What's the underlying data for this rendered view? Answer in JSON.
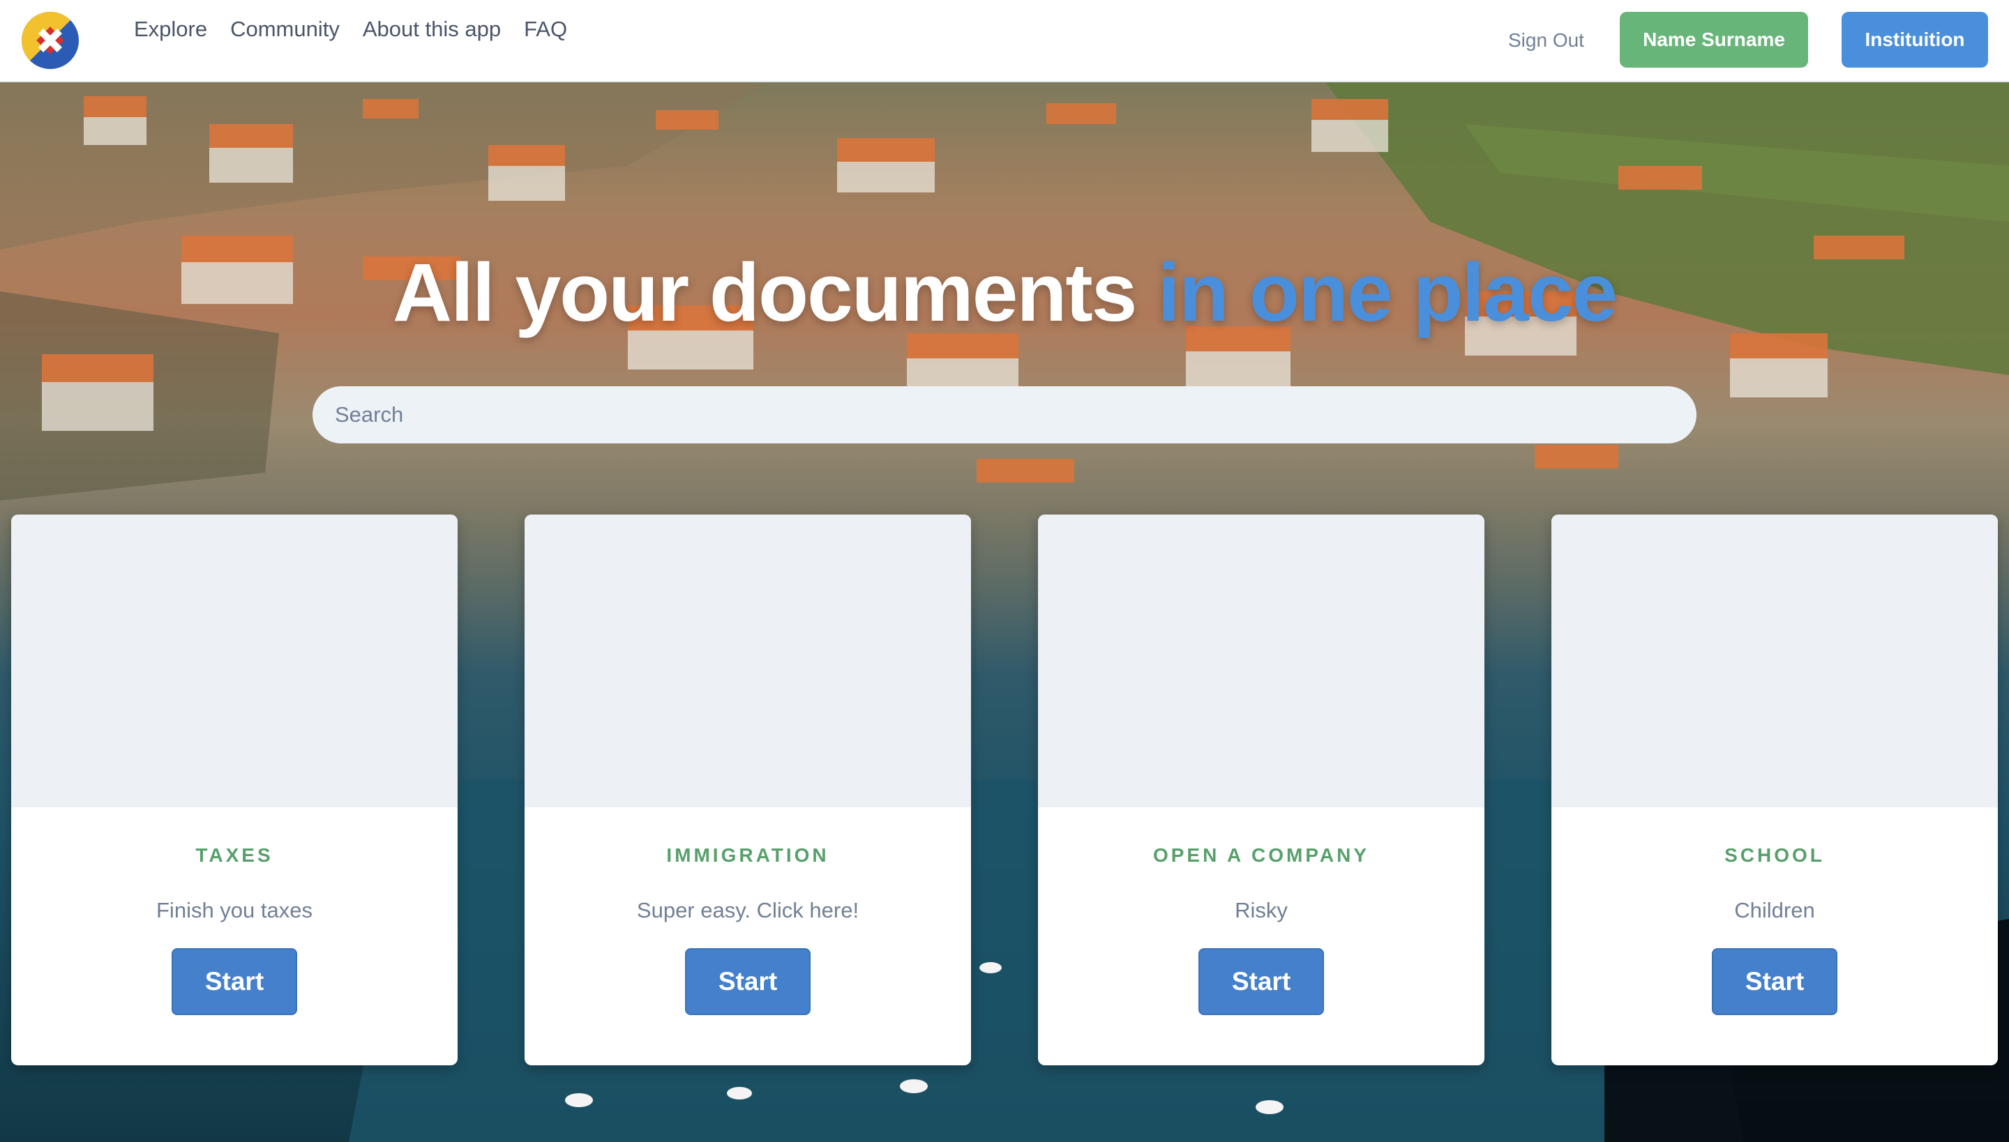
{
  "nav": {
    "links": [
      "Explore",
      "Community",
      "About this app",
      "FAQ"
    ],
    "sign_out": "Sign Out",
    "user_button": "Name Surname",
    "institution_button": "Instituition"
  },
  "hero": {
    "title_main": "All your documents",
    "title_accent": "in one place",
    "search_placeholder": "Search"
  },
  "cards": [
    {
      "title": "TAXES",
      "description": "Finish you taxes",
      "button": "Start"
    },
    {
      "title": "IMMIGRATION",
      "description": "Super easy. Click here!",
      "button": "Start"
    },
    {
      "title": "OPEN A COMPANY",
      "description": "Risky",
      "button": "Start"
    },
    {
      "title": "SCHOOL",
      "description": "Children",
      "button": "Start"
    }
  ],
  "colors": {
    "accent_blue": "#4a8fdb",
    "accent_green": "#68b57a",
    "card_title_green": "#57a06b",
    "button_blue": "#4480cc"
  },
  "icons": {
    "logo": "madeira-flag-logo"
  }
}
